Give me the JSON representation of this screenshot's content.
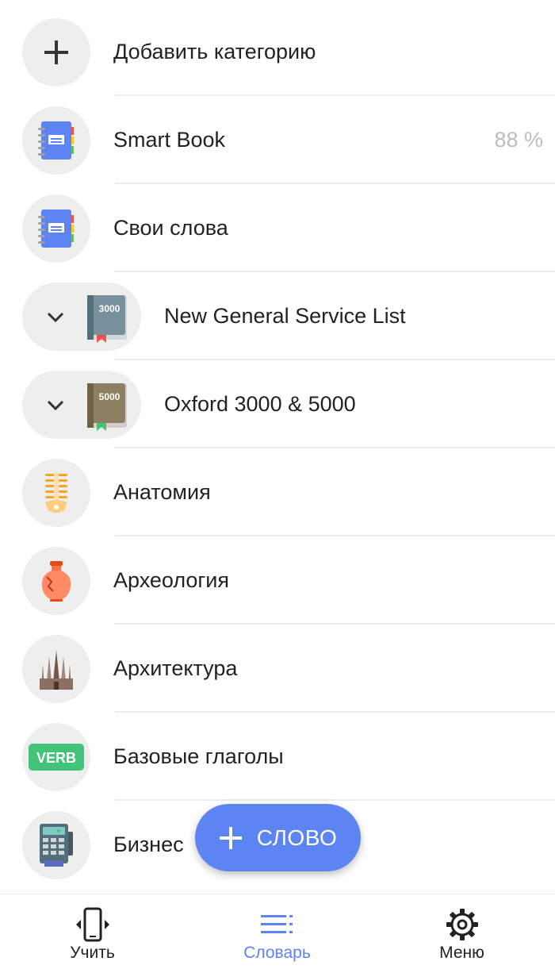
{
  "list": {
    "add_category_label": "Добавить категорию",
    "items": [
      {
        "label": "Smart Book",
        "percent": "88 %"
      },
      {
        "label": "Свои слова"
      },
      {
        "label": "New General Service List",
        "book_number": "3000"
      },
      {
        "label": "Oxford 3000 & 5000",
        "book_number": "5000"
      },
      {
        "label": "Анатомия"
      },
      {
        "label": "Археология"
      },
      {
        "label": "Архитектура"
      },
      {
        "label": "Базовые глаголы",
        "badge": "VERB"
      },
      {
        "label": "Бизнес"
      }
    ]
  },
  "fab": {
    "label": "СЛОВО"
  },
  "bottom_nav": {
    "items": [
      {
        "label": "Учить",
        "icon": "phone-rotate-icon"
      },
      {
        "label": "Словарь",
        "icon": "list-icon",
        "active": true
      },
      {
        "label": "Меню",
        "icon": "gear-icon"
      }
    ]
  },
  "colors": {
    "accent": "#5c84f2",
    "icon_bg": "#eeeeee",
    "verb_green": "#43c27a"
  }
}
